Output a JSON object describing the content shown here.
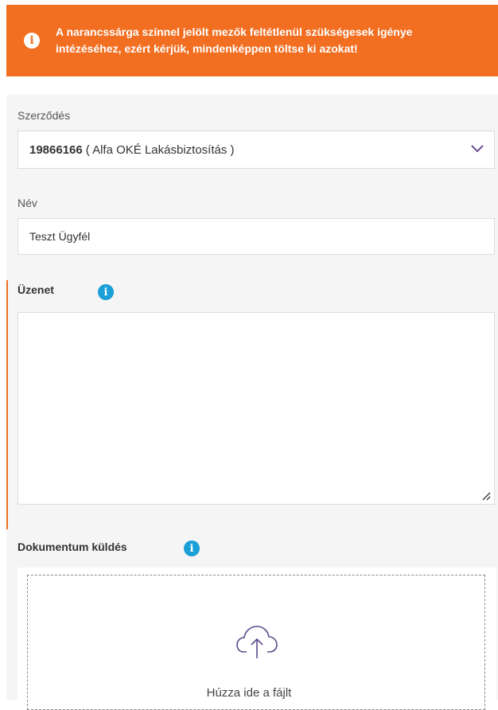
{
  "banner": {
    "icon": "info-icon",
    "text": "A narancssárga színnel jelölt mezők feltétlenül szükségesek igénye intézéséhez, ezért kérjük, mindenképpen töltse ki azokat!",
    "color": "#f26e21"
  },
  "form": {
    "contract": {
      "label": "Szerződés",
      "number": "19866166",
      "name": "( Alfa OKÉ Lakásbiztosítás )"
    },
    "name": {
      "label": "Név",
      "value": "Teszt Ügyfél"
    },
    "message": {
      "label": "Üzenet",
      "value": ""
    },
    "document": {
      "label": "Dokumentum küldés",
      "drop_text": "Húzza ide a fájlt"
    }
  },
  "colors": {
    "accent": "#f26e21",
    "info": "#1a9fd6"
  }
}
